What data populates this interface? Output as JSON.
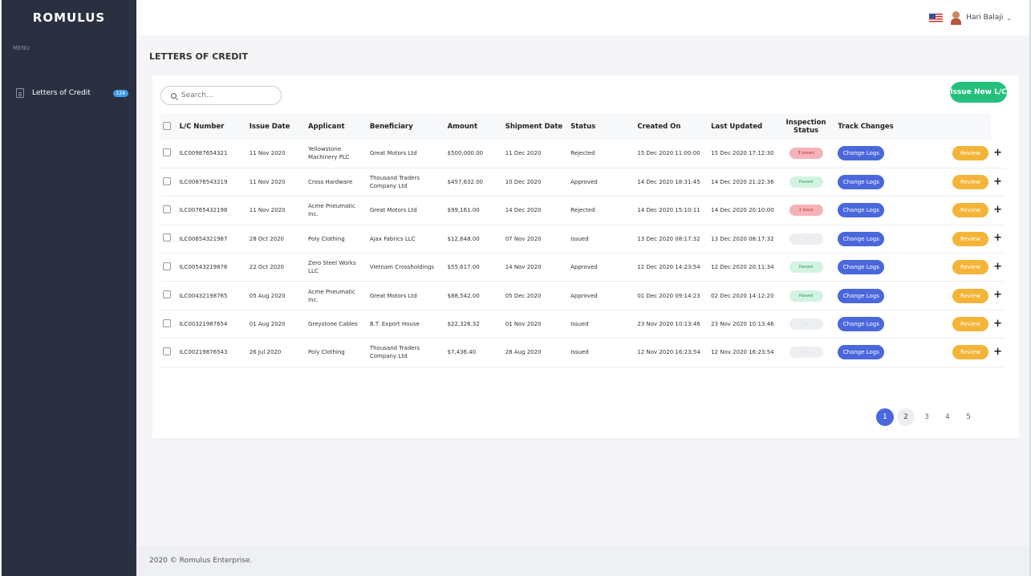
{
  "app": {
    "brand": "ROMULUS"
  },
  "sidebar": {
    "menu_title": "MENU",
    "items": [
      {
        "label": "Letters of Credit",
        "badge": "124"
      }
    ]
  },
  "header": {
    "user_name": "Hari Balaji"
  },
  "page": {
    "title": "LETTERS OF CREDIT"
  },
  "search": {
    "placeholder": "Search..."
  },
  "actions": {
    "issue_new": "Issue New L/C"
  },
  "table": {
    "columns": [
      "L/C Number",
      "Issue Date",
      "Applicant",
      "Beneficiary",
      "Amount",
      "Shipment Date",
      "Status",
      "Created On",
      "Last Updated",
      "Inspection Status",
      "Track Changes"
    ],
    "rows": [
      {
        "lc": "ILC00987654321",
        "issue": "11 Nov 2020",
        "applicant": "Yellowstone Machinery PLC",
        "beneficiary": "Great Motors Ltd",
        "amount": "$500,000.00",
        "shipment": "11 Dec 2020",
        "status": "Rejected",
        "created": "15 Dec 2020 11:00:00",
        "updated": "15 Dec 2020 17:12:30",
        "inspection": "3 Issues",
        "inspection_type": "red"
      },
      {
        "lc": "ILC00876543219",
        "issue": "11 Nov 2020",
        "applicant": "Cross Hardware",
        "beneficiary": "Thousand Traders Company Ltd",
        "amount": "$457,632.00",
        "shipment": "10 Dec 2020",
        "status": "Approved",
        "created": "14 Dec 2020 18:31:45",
        "updated": "14 Dec 2020 21:22:36",
        "inspection": "Passed",
        "inspection_type": "green"
      },
      {
        "lc": "ILC00765432198",
        "issue": "11 Nov 2020",
        "applicant": "Acme Pneumatic Inc.",
        "beneficiary": "Great Motors Ltd",
        "amount": "$99,161.00",
        "shipment": "14 Dec 2020",
        "status": "Rejected",
        "created": "14 Dec 2020 15:10:11",
        "updated": "14 Dec 2020 20:10:00",
        "inspection": "1 Issue",
        "inspection_type": "red"
      },
      {
        "lc": "ILC00654321987",
        "issue": "28 Oct 2020",
        "applicant": "Poly Clothing",
        "beneficiary": "Ajax Fabrics LLC",
        "amount": "$12,648.00",
        "shipment": "07 Nov 2020",
        "status": "Issued",
        "created": "13 Dec 2020 08:17:32",
        "updated": "13 Dec 2020 08:17:32",
        "inspection": "-",
        "inspection_type": "gray"
      },
      {
        "lc": "ILC00543219876",
        "issue": "22 Oct 2020",
        "applicant": "Zero Steel Works LLC",
        "beneficiary": "Vietnam Crossholdings",
        "amount": "$55,617.00",
        "shipment": "14 Nov 2020",
        "status": "Approved",
        "created": "12 Dec 2020 14:23:54",
        "updated": "12 Dec 2020 20:11:34",
        "inspection": "Passed",
        "inspection_type": "green"
      },
      {
        "lc": "ILC00432198765",
        "issue": "05 Aug 2020",
        "applicant": "Acme Pneumatic Inc.",
        "beneficiary": "Great Motors Ltd",
        "amount": "$88,542.00",
        "shipment": "05 Dec 2020",
        "status": "Approved",
        "created": "01 Dec 2020 09:14:23",
        "updated": "02 Dec 2020 14:12:20",
        "inspection": "Passed",
        "inspection_type": "green"
      },
      {
        "lc": "ILC00321987654",
        "issue": "01 Aug 2020",
        "applicant": "Greystone Cables",
        "beneficiary": "B.T. Export House",
        "amount": "$22,326.32",
        "shipment": "01 Nov 2020",
        "status": "Issued",
        "created": "23 Nov 2020 10:13:46",
        "updated": "23 Nov 2020 10:13:46",
        "inspection": "-",
        "inspection_type": "gray"
      },
      {
        "lc": "ILC00219876543",
        "issue": "26 Jul 2020",
        "applicant": "Poly Clothing",
        "beneficiary": "Thousand Traders Company Ltd",
        "amount": "$7,436.40",
        "shipment": "28 Aug 2020",
        "status": "Issued",
        "created": "12 Nov 2020 16:23:54",
        "updated": "12 Nov 2020 16:23:54",
        "inspection": "-",
        "inspection_type": "gray"
      }
    ],
    "change_logs_label": "Change Logs",
    "review_label": "Review",
    "plus_label": "+"
  },
  "pagination": {
    "pages": [
      "1",
      "2",
      "3",
      "4",
      "5"
    ],
    "current": "1"
  },
  "footer": {
    "text": "2020 © Romulus Enterprise."
  }
}
